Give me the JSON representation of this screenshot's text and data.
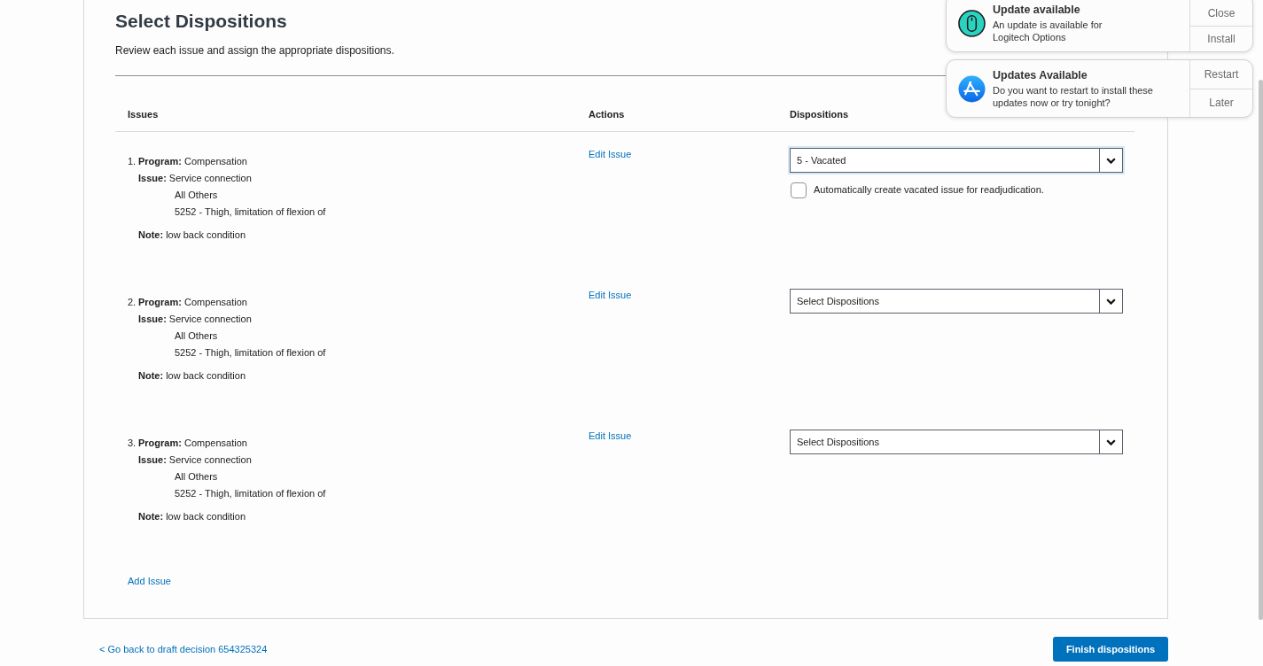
{
  "page": {
    "title": "Select Dispositions",
    "subtitle": "Review each issue and assign the appropriate dispositions."
  },
  "table": {
    "columns": [
      "Issues",
      "Actions",
      "Dispositions"
    ],
    "rows": [
      {
        "number": "1.",
        "program": "**Program:** Compensation",
        "issue": "**Issue:** Service connection",
        "details": [
          "All Others",
          "5252 - Thigh, limitation of flexion of"
        ],
        "note": "**Note:** low back condition",
        "action": "Edit Issue",
        "disposition": {
          "value": "5 - Vacated",
          "focused": true,
          "checkbox": {
            "label": "Automatically create vacated issue for readjudication.",
            "checked": false
          }
        }
      },
      {
        "number": "2.",
        "program": "**Program:** Compensation",
        "issue": "**Issue:** Service connection",
        "details": [
          "All Others",
          "5252 - Thigh, limitation of flexion of"
        ],
        "note": "**Note:** low back condition",
        "action": "Edit Issue",
        "disposition": {
          "placeholder": "Select Dispositions",
          "focused": false
        }
      },
      {
        "number": "3.",
        "program": "**Program:** Compensation",
        "issue": "**Issue:** Service connection",
        "details": [
          "All Others",
          "5252 - Thigh, limitation of flexion of"
        ],
        "note": "**Note:** low back condition",
        "action": "Edit Issue",
        "disposition": {
          "placeholder": "Select Dispositions",
          "focused": false
        }
      }
    ]
  },
  "add_link": "Add Issue",
  "footer": {
    "back_link": "< Go back to draft decision 654325324",
    "finish_button": "Finish dispositions"
  },
  "notifications": [
    {
      "kind": "accessory",
      "title": "Update available",
      "body": "An update is available for\nLogitech Options",
      "buttons": [
        "Close",
        "Install"
      ]
    },
    {
      "kind": "store",
      "title": "Updates Available",
      "body": "Do you want to restart to install these\nupdates now or try tonight?",
      "buttons": [
        "Restart",
        "Later"
      ]
    }
  ]
}
